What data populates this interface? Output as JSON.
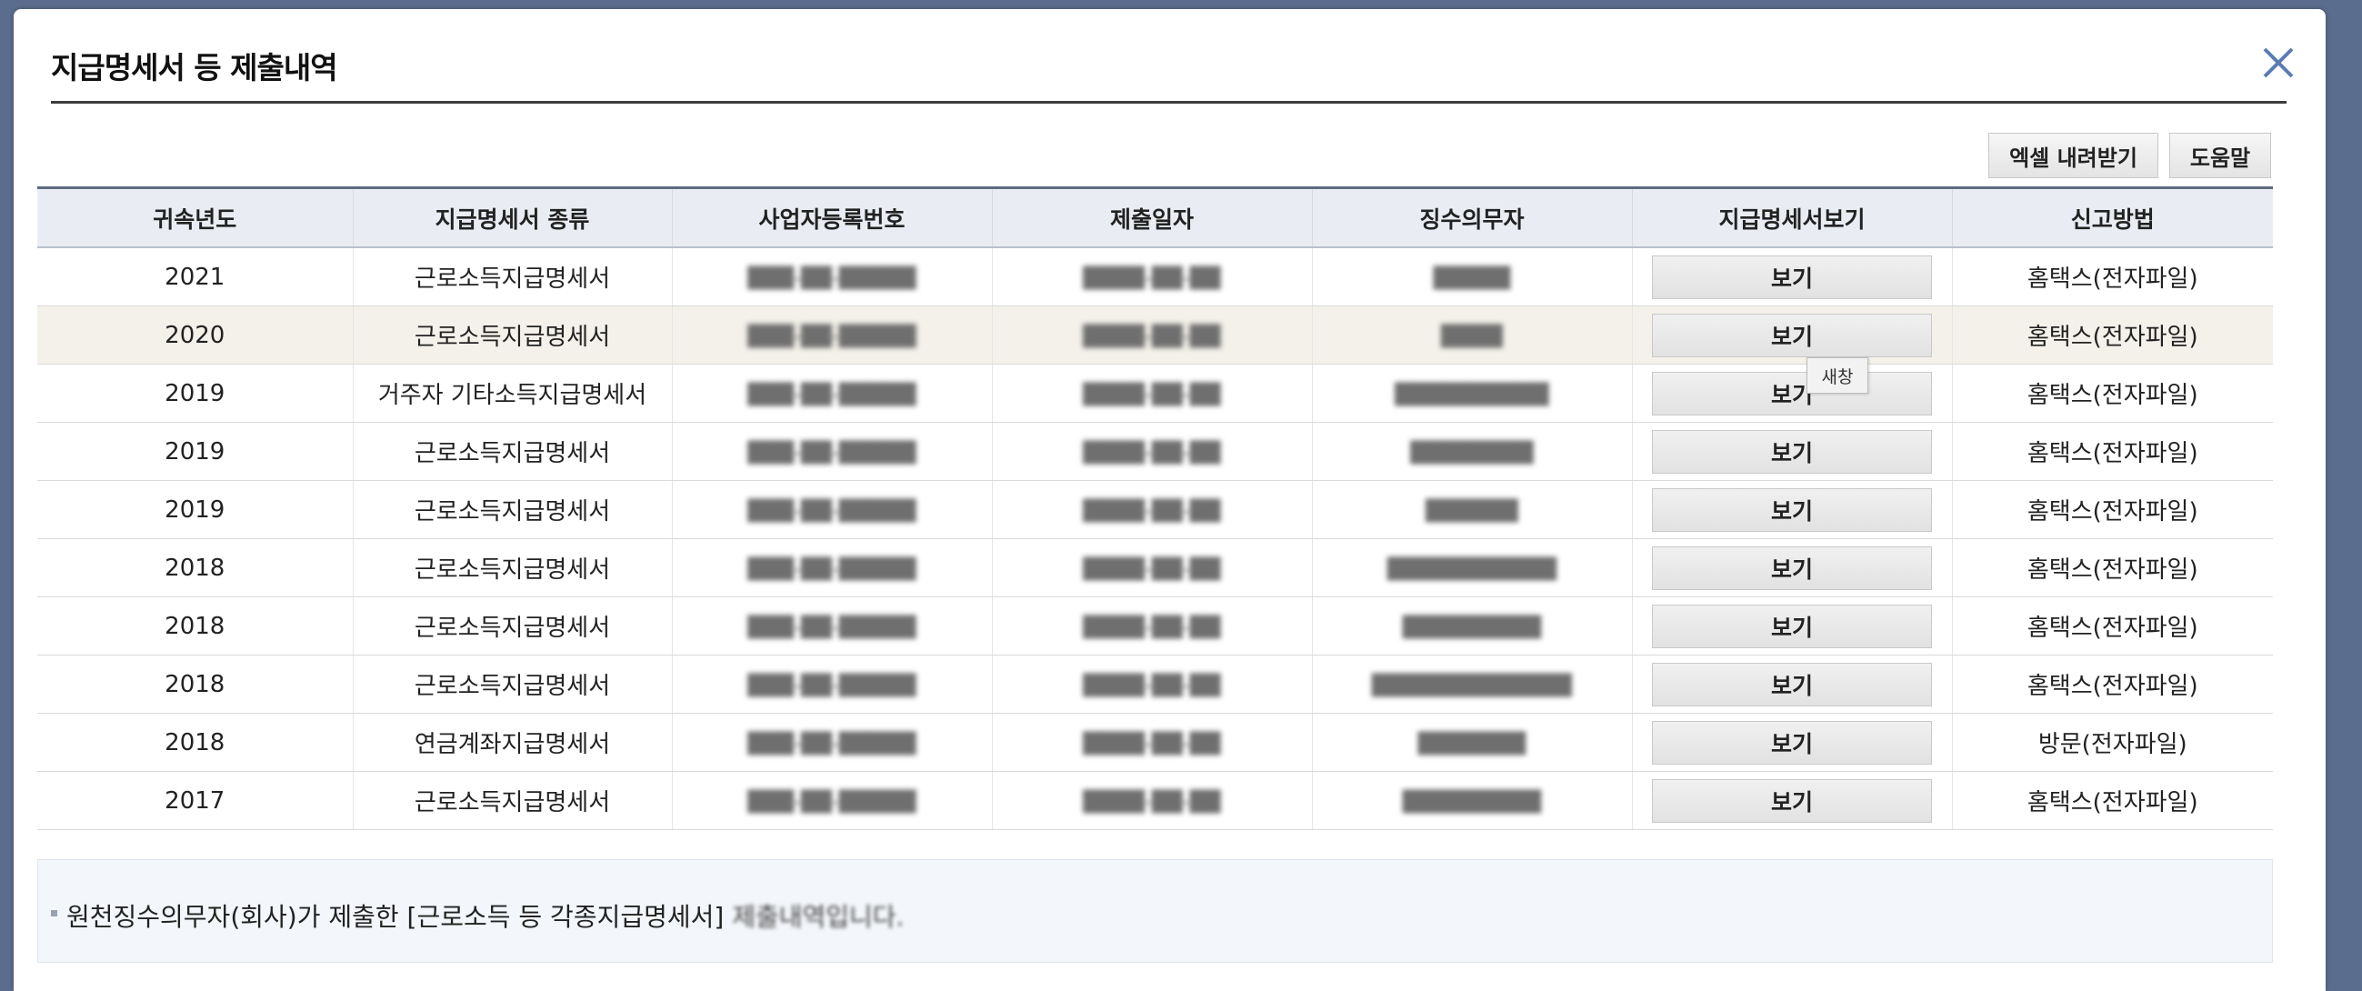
{
  "dialog": {
    "title": "지급명세서 등 제출내역"
  },
  "toolbar": {
    "excel_label": "엑셀 내려받기",
    "help_label": "도움말"
  },
  "table": {
    "columns": [
      "귀속년도",
      "지급명세서 종류",
      "사업자등록번호",
      "제출일자",
      "징수의무자",
      "지급명세서보기",
      "신고방법"
    ],
    "view_label": "보기",
    "rows": [
      {
        "year": "2021",
        "type": "근로소득지급명세서",
        "method": "홈택스(전자파일)"
      },
      {
        "year": "2020",
        "type": "근로소득지급명세서",
        "method": "홈택스(전자파일)"
      },
      {
        "year": "2019",
        "type": "거주자 기타소득지급명세서",
        "method": "홈택스(전자파일)"
      },
      {
        "year": "2019",
        "type": "근로소득지급명세서",
        "method": "홈택스(전자파일)"
      },
      {
        "year": "2019",
        "type": "근로소득지급명세서",
        "method": "홈택스(전자파일)"
      },
      {
        "year": "2018",
        "type": "근로소득지급명세서",
        "method": "홈택스(전자파일)"
      },
      {
        "year": "2018",
        "type": "근로소득지급명세서",
        "method": "홈택스(전자파일)"
      },
      {
        "year": "2018",
        "type": "근로소득지급명세서",
        "method": "홈택스(전자파일)"
      },
      {
        "year": "2018",
        "type": "연금계좌지급명세서",
        "method": "방문(전자파일)"
      },
      {
        "year": "2017",
        "type": "근로소득지급명세서",
        "method": "홈택스(전자파일)"
      }
    ]
  },
  "tooltip": {
    "text": "새창"
  },
  "note": {
    "text_main": "원천징수의무자(회사)가 제출한 [근로소득 등 각종지급명세서] ",
    "text_tail": "제출내역입니다."
  },
  "colors": {
    "header_bg": "#e9edf3",
    "highlight_row": "#f4f1ea",
    "close_icon": "#5b7bb5"
  }
}
